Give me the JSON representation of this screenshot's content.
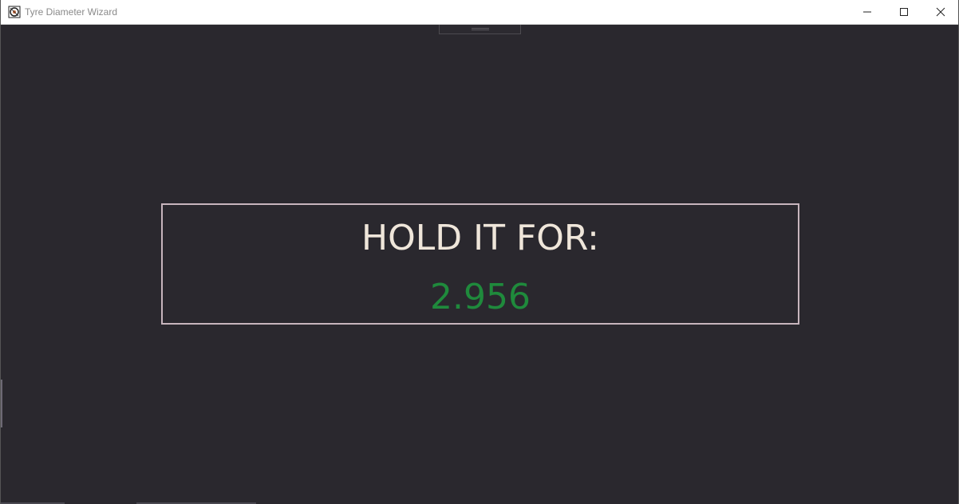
{
  "window": {
    "title": "Tyre Diameter Wizard",
    "icon": "tire-icon"
  },
  "controls": {
    "minimize_icon": "minimize-icon",
    "maximize_icon": "maximize-icon",
    "close_icon": "close-icon"
  },
  "panel": {
    "label": "HOLD IT FOR:",
    "value": "2.956"
  },
  "colors": {
    "background": "#2a282e",
    "label": "#efe6da",
    "value": "#1f8a3c",
    "panel_border": "#c7b5bd"
  }
}
